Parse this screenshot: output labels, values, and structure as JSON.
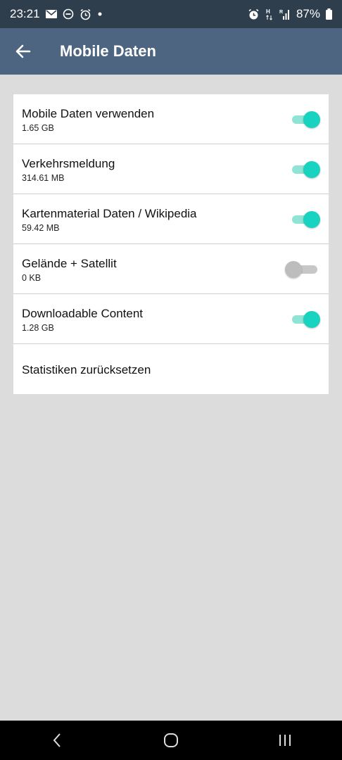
{
  "status_bar": {
    "time": "23:21",
    "battery": "87%",
    "left_icons": [
      "mail-icon",
      "do-not-disturb-icon",
      "alarm-icon",
      "dot-icon"
    ],
    "right_icons": [
      "alarm-icon",
      "network-h-icon",
      "signal-icon",
      "battery-icon"
    ]
  },
  "app_bar": {
    "title": "Mobile Daten",
    "back_icon": "arrow-left-icon",
    "color": "#4d6580"
  },
  "settings": {
    "items": [
      {
        "label": "Mobile Daten verwenden",
        "value": "1.65 GB",
        "toggle": true
      },
      {
        "label": "Verkehrsmeldung",
        "value": "314.61 MB",
        "toggle": true
      },
      {
        "label": "Kartenmaterial Daten / Wikipedia",
        "value": "59.42 MB",
        "toggle": true
      },
      {
        "label": "Gelände + Satellit",
        "value": "0 KB",
        "toggle": false
      },
      {
        "label": "Downloadable Content",
        "value": "1.28 GB",
        "toggle": true
      }
    ],
    "reset_label": "Statistiken zurücksetzen"
  },
  "colors": {
    "accent": "#18d3bf",
    "status_bar": "#2f3e4c",
    "background": "#dcdcdc"
  },
  "nav_bar": {
    "icons": [
      "back-nav-icon",
      "home-nav-icon",
      "recents-nav-icon"
    ]
  }
}
